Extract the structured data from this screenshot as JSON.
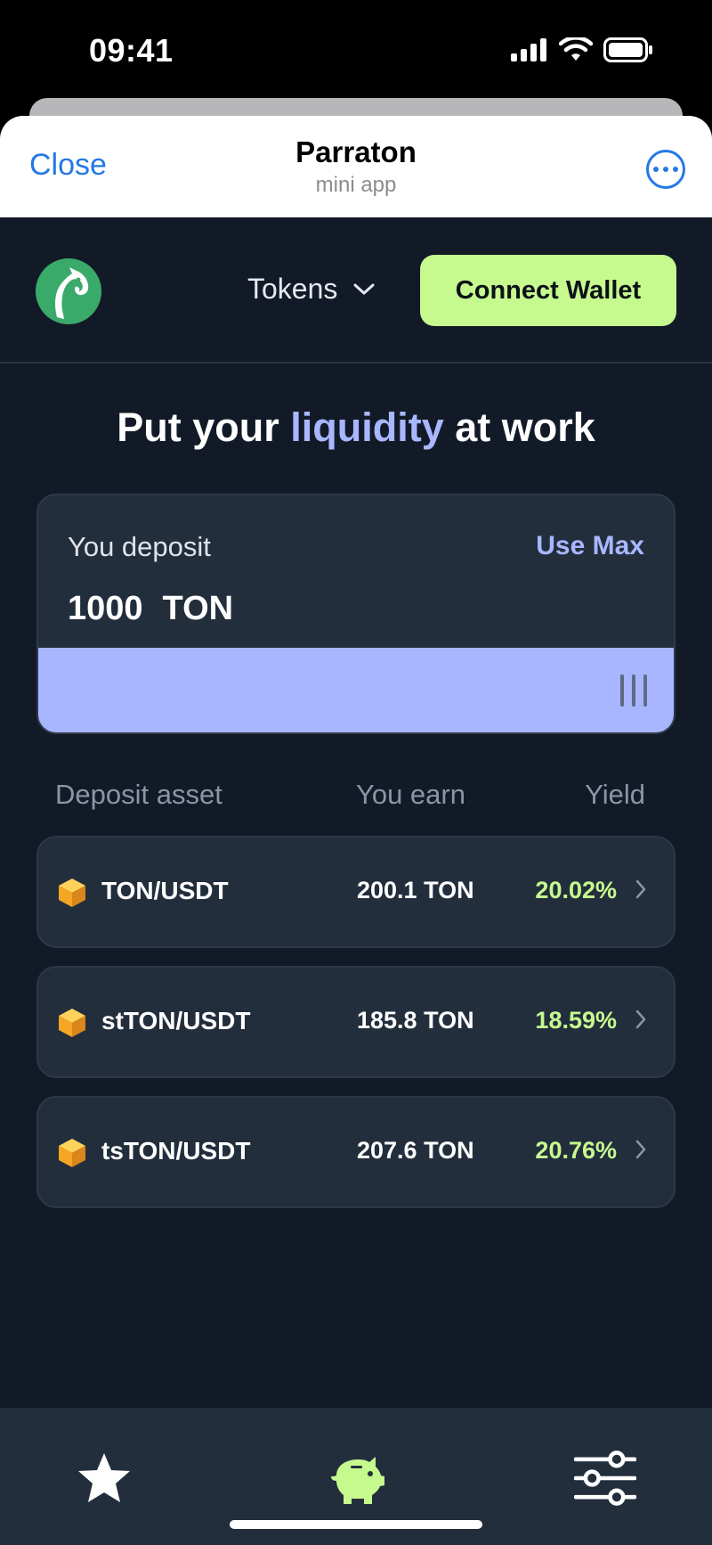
{
  "status_bar": {
    "time": "09:41",
    "icons": [
      "cellular-signal-icon",
      "wifi-icon",
      "battery-icon"
    ]
  },
  "sheet": {
    "close_label": "Close",
    "title": "Parraton",
    "subtitle": "mini app",
    "more_icon": "ellipsis-circle-icon"
  },
  "nav": {
    "logo_icon": "parrot-logo-icon",
    "tokens_label": "Tokens",
    "connect_label": "Connect Wallet"
  },
  "headline": {
    "prefix": "Put your ",
    "accent": "liquidity",
    "suffix": " at work"
  },
  "deposit": {
    "label": "You deposit",
    "use_max_label": "Use Max",
    "amount": "1000",
    "currency": "TON"
  },
  "table": {
    "headers": {
      "asset": "Deposit asset",
      "earn": "You earn",
      "yield": "Yield"
    },
    "rows": [
      {
        "pair": "TON/USDT",
        "earn": "200.1 TON",
        "yield": "20.02%"
      },
      {
        "pair": "stTON/USDT",
        "earn": "185.8 TON",
        "yield": "18.59%"
      },
      {
        "pair": "tsTON/USDT",
        "earn": "207.6 TON",
        "yield": "20.76%"
      }
    ]
  },
  "tabs": {
    "items": [
      "star-icon",
      "piggy-bank-icon",
      "sliders-icon"
    ],
    "active": "piggy-bank-icon"
  },
  "colors": {
    "background": "#121a27",
    "card": "#232e3d",
    "accent_lavender": "#a8b7ff",
    "accent_green": "#c6f98e",
    "link_blue": "#2479e4"
  }
}
